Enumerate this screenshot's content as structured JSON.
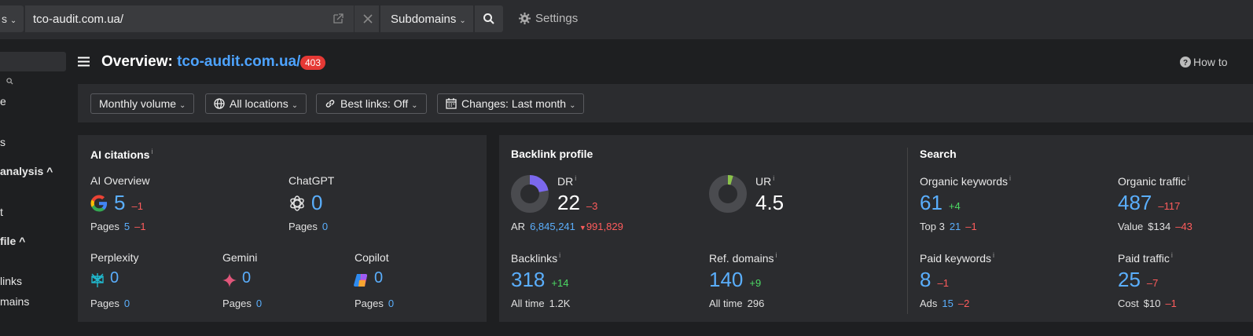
{
  "topbar": {
    "mode_label": "s",
    "url": "tco-audit.com.ua/",
    "subdomains_label": "Subdomains",
    "settings_label": "Settings"
  },
  "sidebar": {
    "items": [
      {
        "label": "e"
      },
      {
        "label": "s"
      },
      {
        "label": " analysis ^"
      },
      {
        "label": "t"
      },
      {
        "label": "file ^"
      },
      {
        "label": "links"
      },
      {
        "label": "mains"
      }
    ]
  },
  "header": {
    "title_prefix": "Overview:",
    "domain": "tco-audit.com.ua/",
    "badge": "403",
    "how_to": "How to"
  },
  "filters": {
    "volume": "Monthly volume",
    "locations": "All locations",
    "best_links": "Best links: Off",
    "changes": "Changes: Last month"
  },
  "ai_citations": {
    "title": "AI citations",
    "info": "i",
    "ai_overview": {
      "label": "AI Overview",
      "value": "5",
      "delta": "–1",
      "pages_label": "Pages",
      "pages": "5",
      "pages_delta": "–1"
    },
    "chatgpt": {
      "label": "ChatGPT",
      "value": "0",
      "pages_label": "Pages",
      "pages": "0"
    },
    "perplexity": {
      "label": "Perplexity",
      "value": "0",
      "pages_label": "Pages",
      "pages": "0"
    },
    "gemini": {
      "label": "Gemini",
      "value": "0",
      "pages_label": "Pages",
      "pages": "0"
    },
    "copilot": {
      "label": "Copilot",
      "value": "0",
      "pages_label": "Pages",
      "pages": "0"
    }
  },
  "backlink_profile": {
    "title": "Backlink profile",
    "dr": {
      "label": "DR",
      "value": "22",
      "delta": "–3",
      "fraction": 0.22
    },
    "ar": {
      "label": "AR",
      "value": "6,845,241",
      "delta": "991,829"
    },
    "ur": {
      "label": "UR",
      "value": "4.5",
      "fraction": 0.045
    },
    "backlinks": {
      "label": "Backlinks",
      "value": "318",
      "delta": "+14",
      "all_time_label": "All time",
      "all_time": "1.2K"
    },
    "ref_domains": {
      "label": "Ref. domains",
      "value": "140",
      "delta": "+9",
      "all_time_label": "All time",
      "all_time": "296"
    }
  },
  "search": {
    "title": "Search",
    "organic_keywords": {
      "label": "Organic keywords",
      "value": "61",
      "delta": "+4",
      "sub_label": "Top 3",
      "sub_value": "21",
      "sub_delta": "–1"
    },
    "organic_traffic": {
      "label": "Organic traffic",
      "value": "487",
      "delta": "–117",
      "sub_label": "Value",
      "sub_value": "$134",
      "sub_delta": "–43"
    },
    "paid_keywords": {
      "label": "Paid keywords",
      "value": "8",
      "delta": "–1",
      "sub_label": "Ads",
      "sub_value": "15",
      "sub_delta": "–2"
    },
    "paid_traffic": {
      "label": "Paid traffic",
      "value": "25",
      "delta": "–7",
      "sub_label": "Cost",
      "sub_value": "$10",
      "sub_delta": "–1"
    }
  },
  "colors": {
    "accent": "#5aaefc",
    "negative": "#ff5c5c",
    "positive": "#4cd964",
    "dr_fill": "#7b68ee",
    "ur_fill": "#8bc34a",
    "badge": "#e53935"
  }
}
